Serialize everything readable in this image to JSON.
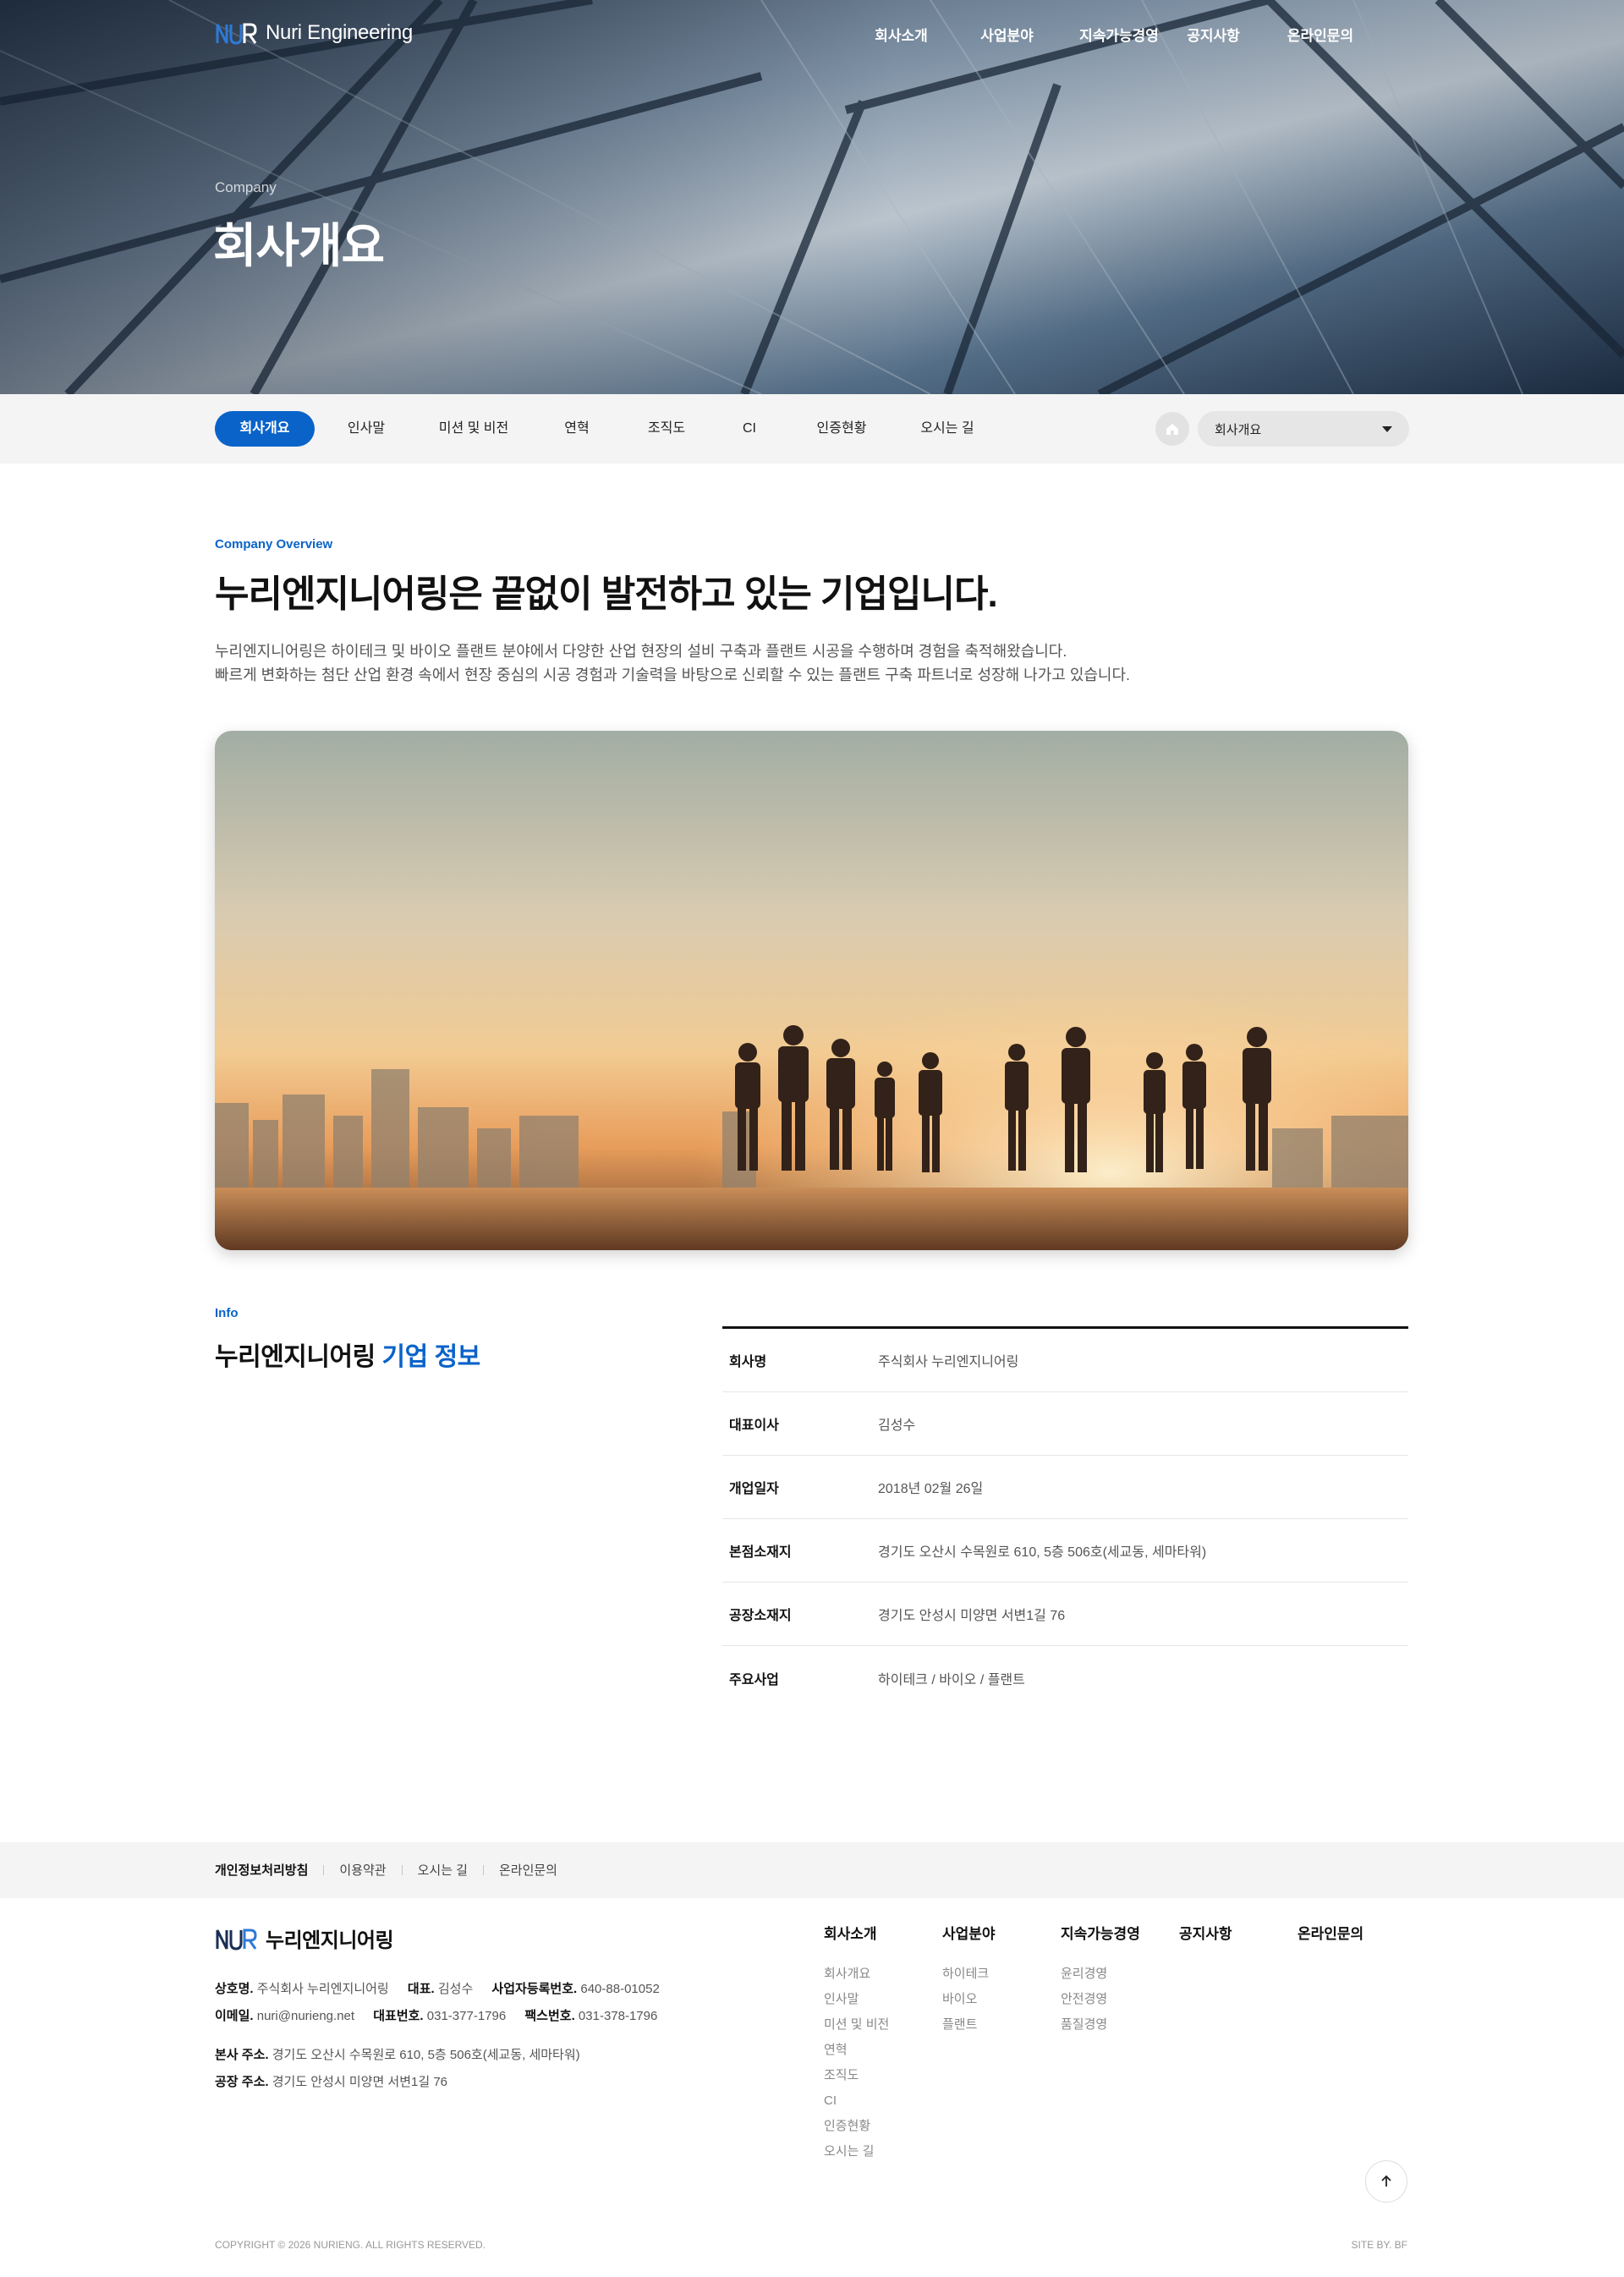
{
  "header": {
    "logo_text": "Nuri Engineering",
    "nav": [
      "회사소개",
      "사업분야",
      "지속가능경영",
      "공지사항",
      "온라인문의"
    ]
  },
  "hero": {
    "subtitle": "Company",
    "title": "회사개요"
  },
  "subnav": {
    "tabs": [
      "회사개요",
      "인사말",
      "미션 및 비전",
      "연혁",
      "조직도",
      "CI",
      "인증현황",
      "오시는 길"
    ],
    "active_index": 0,
    "select_value": "회사개요",
    "home_icon": "home-icon"
  },
  "overview": {
    "eyebrow": "Company Overview",
    "title": "누리엔지니어링은 끝없이 발전하고 있는 기업입니다.",
    "desc_line1": "누리엔지니어링은 하이테크 및 바이오 플랜트 분야에서 다양한 산업 현장의 설비 구축과 플랜트 시공을 수행하며 경험을 축적해왔습니다.",
    "desc_line2": "빠르게 변화하는 첨단 산업 환경 속에서 현장 중심의 시공 경험과 기술력을 바탕으로 신뢰할 수 있는 플랜트 구축 파트너로 성장해 나가고 있습니다."
  },
  "info": {
    "eyebrow": "Info",
    "title_main": "누리엔지니어링",
    "title_highlight": "기업 정보",
    "rows": [
      {
        "label": "회사명",
        "value": "주식회사 누리엔지니어링"
      },
      {
        "label": "대표이사",
        "value": "김성수"
      },
      {
        "label": "개업일자",
        "value": "2018년 02월 26일"
      },
      {
        "label": "본점소재지",
        "value": "경기도 오산시 수목원로 610, 5층 506호(세교동, 세마타워)"
      },
      {
        "label": "공장소재지",
        "value": "경기도 안성시 미양면 서변1길 76"
      },
      {
        "label": "주요사업",
        "value": "하이테크 / 바이오 / 플랜트"
      }
    ]
  },
  "footer": {
    "links": [
      "개인정보처리방침",
      "이용약관",
      "오시는 길",
      "온라인문의"
    ],
    "logo_text": "누리엔지니어링",
    "company_label": "상호명.",
    "company_value": "주식회사 누리엔지니어링",
    "ceo_label": "대표.",
    "ceo_value": "김성수",
    "biz_label": "사업자등록번호.",
    "biz_value": "640-88-01052",
    "email_label": "이메일.",
    "email_value": "nuri@nurieng.net",
    "tel_label": "대표번호.",
    "tel_value": "031-377-1796",
    "fax_label": "팩스번호.",
    "fax_value": "031-378-1796",
    "hq_label": "본사 주소.",
    "hq_value": "경기도 오산시 수목원로 610, 5층 506호(세교동, 세마타워)",
    "factory_label": "공장 주소.",
    "factory_value": "경기도 안성시 미양면 서변1길 76",
    "sitemap": [
      {
        "title": "회사소개",
        "items": [
          "회사개요",
          "인사말",
          "미션 및 비전",
          "연혁",
          "조직도",
          "CI",
          "인증현황",
          "오시는 길"
        ]
      },
      {
        "title": "사업분야",
        "items": [
          "하이테크",
          "바이오",
          "플랜트"
        ]
      },
      {
        "title": "지속가능경영",
        "items": [
          "윤리경영",
          "안전경영",
          "품질경영"
        ]
      },
      {
        "title": "공지사항",
        "items": []
      },
      {
        "title": "온라인문의",
        "items": []
      }
    ],
    "copyright": "COPYRIGHT © 2026 NURIENG. ALL RIGHTS RESERVED.",
    "siteby": "SITE BY. BF",
    "top_icon": "arrow-up-icon"
  },
  "colors": {
    "accent": "#0a63c9",
    "subnav_bg": "#f4f4f4"
  }
}
